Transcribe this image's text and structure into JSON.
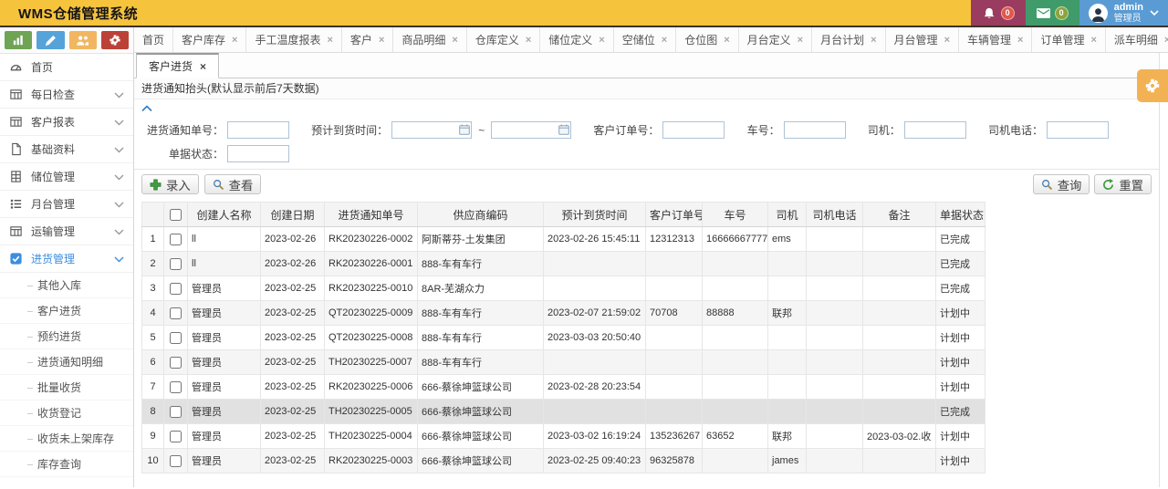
{
  "header": {
    "title": "WMS仓储管理系统",
    "bell_count": "0",
    "mail_count": "0",
    "user": {
      "name": "admin",
      "role": "管理员"
    }
  },
  "quick_buttons": [
    {
      "icon": "bar-chart",
      "color": "#6fa454"
    },
    {
      "icon": "pencil",
      "color": "#56a3d9"
    },
    {
      "icon": "users",
      "color": "#f2b661"
    },
    {
      "icon": "gears",
      "color": "#bc4237"
    }
  ],
  "close_glyph": "×",
  "top_tabs": [
    {
      "label": "首页",
      "closable": false
    },
    {
      "label": "客户库存",
      "closable": true
    },
    {
      "label": "手工温度报表",
      "closable": true
    },
    {
      "label": "客户",
      "closable": true
    },
    {
      "label": "商品明细",
      "closable": true
    },
    {
      "label": "仓库定义",
      "closable": true
    },
    {
      "label": "储位定义",
      "closable": true
    },
    {
      "label": "空储位",
      "closable": true
    },
    {
      "label": "仓位图",
      "closable": true
    },
    {
      "label": "月台定义",
      "closable": true
    },
    {
      "label": "月台计划",
      "closable": true
    },
    {
      "label": "月台管理",
      "closable": true
    },
    {
      "label": "车辆管理",
      "closable": true
    },
    {
      "label": "订单管理",
      "closable": true
    },
    {
      "label": "派车明细",
      "closable": true
    }
  ],
  "sidebar": {
    "items": [
      {
        "label": "首页",
        "icon": "gauge",
        "expandable": false,
        "active": false
      },
      {
        "label": "每日检查",
        "icon": "report",
        "expandable": true,
        "active": false
      },
      {
        "label": "客户报表",
        "icon": "report",
        "expandable": true,
        "active": false
      },
      {
        "label": "基础资料",
        "icon": "file",
        "expandable": true,
        "active": false
      },
      {
        "label": "储位管理",
        "icon": "storage",
        "expandable": true,
        "active": false
      },
      {
        "label": "月台管理",
        "icon": "list",
        "expandable": true,
        "active": false
      },
      {
        "label": "运输管理",
        "icon": "report",
        "expandable": true,
        "active": false
      },
      {
        "label": "进货管理",
        "icon": "checkbox",
        "expandable": true,
        "active": true
      }
    ],
    "subitems": [
      "其他入库",
      "客户进货",
      "预约进货",
      "进货通知明细",
      "批量收货",
      "收货登记",
      "收货未上架库存",
      "库存查询"
    ]
  },
  "content": {
    "page_tab_label": "客户进货",
    "panel_title": "进货通知抬头(默认显示前后7天数据)",
    "form": {
      "range_separator": "~",
      "row1": [
        {
          "label": "进货通知单号：",
          "type": "text",
          "name": "notice-no-input",
          "wide_label": true
        },
        {
          "label": "预计到货时间：",
          "type": "daterange",
          "name": "eta-range-input",
          "wide_label": false
        },
        {
          "label": "客户订单号：",
          "type": "text",
          "name": "customer-order-input",
          "wide_label": false
        },
        {
          "label": "车号：",
          "type": "text",
          "name": "truck-no-input",
          "wide_label": false
        },
        {
          "label": "司机：",
          "type": "text",
          "name": "driver-input",
          "wide_label": false
        },
        {
          "label": "司机电话：",
          "type": "text",
          "name": "driver-phone-input",
          "wide_label": false
        }
      ],
      "row2": [
        {
          "label": "单据状态：",
          "type": "text",
          "name": "doc-status-input",
          "wide_label": true
        }
      ]
    },
    "toolbar": {
      "add": "录入",
      "view": "查看",
      "query": "查询",
      "reset": "重置"
    },
    "table": {
      "columns": [
        "创建人名称",
        "创建日期",
        "进货通知单号",
        "供应商编码",
        "预计到货时间",
        "客户订单号",
        "车号",
        "司机",
        "司机电话",
        "备注",
        "单据状态"
      ],
      "rows": [
        {
          "num": "1",
          "creator": "ll",
          "date": "2023-02-26",
          "notice_no": "RK20230226-0002",
          "supplier": "阿斯蒂芬-土发集团",
          "eta": "2023-02-26 15:45:11",
          "order_no": "12312313",
          "truck_no": "16666667777",
          "driver": "ems",
          "phone": "",
          "remark": "",
          "status": "已完成",
          "selected": false
        },
        {
          "num": "2",
          "creator": "ll",
          "date": "2023-02-26",
          "notice_no": "RK20230226-0001",
          "supplier": "888-车有车行",
          "eta": "",
          "order_no": "",
          "truck_no": "",
          "driver": "",
          "phone": "",
          "remark": "",
          "status": "已完成",
          "selected": false
        },
        {
          "num": "3",
          "creator": "管理员",
          "date": "2023-02-25",
          "notice_no": "RK20230225-0010",
          "supplier": "8AR-芜湖众力",
          "eta": "",
          "order_no": "",
          "truck_no": "",
          "driver": "",
          "phone": "",
          "remark": "",
          "status": "已完成",
          "selected": false
        },
        {
          "num": "4",
          "creator": "管理员",
          "date": "2023-02-25",
          "notice_no": "QT20230225-0009",
          "supplier": "888-车有车行",
          "eta": "2023-02-07 21:59:02",
          "order_no": "70708",
          "truck_no": "88888",
          "driver": "联邦",
          "phone": "",
          "remark": "",
          "status": "计划中",
          "selected": false
        },
        {
          "num": "5",
          "creator": "管理员",
          "date": "2023-02-25",
          "notice_no": "QT20230225-0008",
          "supplier": "888-车有车行",
          "eta": "2023-03-03 20:50:40",
          "order_no": "",
          "truck_no": "",
          "driver": "",
          "phone": "",
          "remark": "",
          "status": "计划中",
          "selected": false
        },
        {
          "num": "6",
          "creator": "管理员",
          "date": "2023-02-25",
          "notice_no": "TH20230225-0007",
          "supplier": "888-车有车行",
          "eta": "",
          "order_no": "",
          "truck_no": "",
          "driver": "",
          "phone": "",
          "remark": "",
          "status": "计划中",
          "selected": false
        },
        {
          "num": "7",
          "creator": "管理员",
          "date": "2023-02-25",
          "notice_no": "RK20230225-0006",
          "supplier": "666-蔡徐坤篮球公司",
          "eta": "2023-02-28 20:23:54",
          "order_no": "",
          "truck_no": "",
          "driver": "",
          "phone": "",
          "remark": "",
          "status": "计划中",
          "selected": false
        },
        {
          "num": "8",
          "creator": "管理员",
          "date": "2023-02-25",
          "notice_no": "TH20230225-0005",
          "supplier": "666-蔡徐坤篮球公司",
          "eta": "",
          "order_no": "",
          "truck_no": "",
          "driver": "",
          "phone": "",
          "remark": "",
          "status": "已完成",
          "selected": true
        },
        {
          "num": "9",
          "creator": "管理员",
          "date": "2023-02-25",
          "notice_no": "TH20230225-0004",
          "supplier": "666-蔡徐坤篮球公司",
          "eta": "2023-03-02 16:19:24",
          "order_no": "135236267",
          "truck_no": "63652",
          "driver": "联邦",
          "phone": "",
          "remark": "2023-03-02.收",
          "status": "计划中",
          "selected": false
        },
        {
          "num": "10",
          "creator": "管理员",
          "date": "2023-02-25",
          "notice_no": "RK20230225-0003",
          "supplier": "666-蔡徐坤篮球公司",
          "eta": "2023-02-25 09:40:23",
          "order_no": "96325878",
          "truck_no": "",
          "driver": "james",
          "phone": "",
          "remark": "",
          "status": "计划中",
          "selected": false
        }
      ]
    }
  }
}
